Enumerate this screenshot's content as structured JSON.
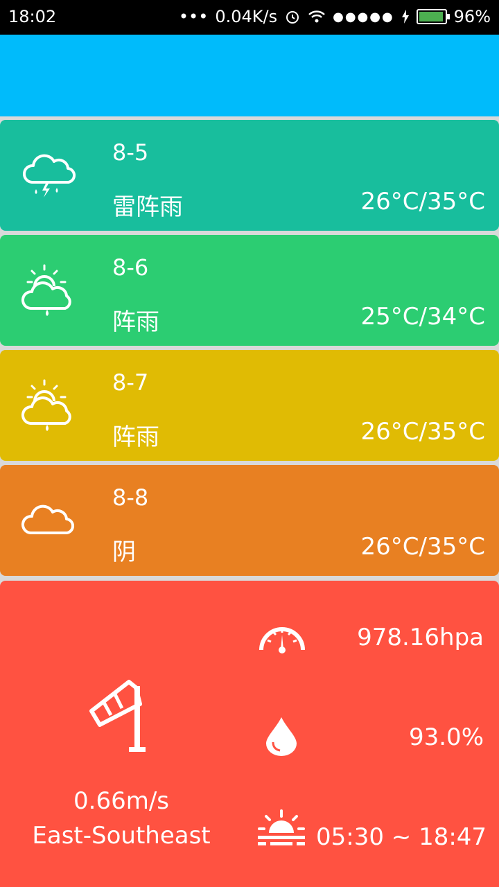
{
  "status": {
    "time": "18:02",
    "dots": "•••",
    "speed": "0.04K/s",
    "signal": "●●●●●",
    "battery": "96%"
  },
  "forecast": [
    {
      "date": "8-5",
      "condition": "雷阵雨",
      "temp": "26°C/35°C",
      "icon": "thunderstorm-icon",
      "color": "#18be9d"
    },
    {
      "date": "8-6",
      "condition": "阵雨",
      "temp": "25°C/34°C",
      "icon": "shower-icon",
      "color": "#2ccd72"
    },
    {
      "date": "8-7",
      "condition": "阵雨",
      "temp": "26°C/35°C",
      "icon": "shower-icon",
      "color": "#e0bb04"
    },
    {
      "date": "8-8",
      "condition": "阴",
      "temp": "26°C/35°C",
      "icon": "cloudy-icon",
      "color": "#e88022"
    }
  ],
  "details": {
    "wind_speed": "0.66m/s",
    "wind_direction": "East-Southeast",
    "pressure": "978.16hpa",
    "humidity": "93.0%",
    "sun_times": "05:30 ~ 18:47",
    "color": "#ff5241"
  }
}
